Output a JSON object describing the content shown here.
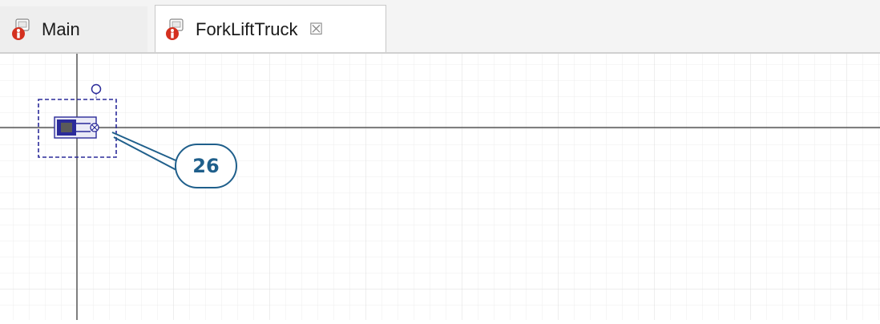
{
  "tabs": [
    {
      "label": "Main",
      "icon": "agent-icon"
    },
    {
      "label": "ForkLiftTruck",
      "icon": "agent-icon",
      "active": true,
      "close_icon": "close-icon"
    }
  ],
  "callout": {
    "label": "26"
  },
  "colors": {
    "grid_line": "#e2e2e2",
    "axis_line": "#555555",
    "selection": "#2b2b9a",
    "callout": "#1f5f8b",
    "icon_red": "#d4301f"
  }
}
